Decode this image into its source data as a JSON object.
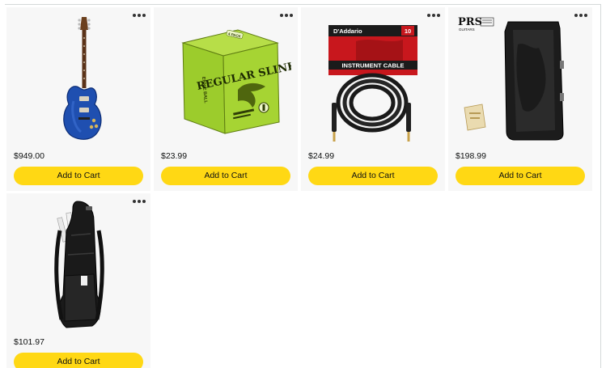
{
  "products": [
    {
      "image": "electric-guitar-image",
      "price": "$949.00",
      "cta": "Add to Cart"
    },
    {
      "image": "guitar-strings-4-pack-image",
      "price": "$23.99",
      "cta": "Add to Cart"
    },
    {
      "image": "instrument-cable-image",
      "price": "$24.99",
      "cta": "Add to Cart"
    },
    {
      "image": "guitar-hardshell-case-image",
      "price": "$198.99",
      "cta": "Add to Cart"
    },
    {
      "image": "double-guitar-gig-bag-image",
      "price": "$101.97",
      "cta": "Add to Cart"
    }
  ],
  "product_labels": {
    "strings_box_brand": "ERNIE BALL",
    "strings_box_pack": "4 PACK",
    "strings_box_name": "REGULAR SLINKY",
    "cable_brand": "D'Addario",
    "cable_label": "INSTRUMENT CABLE",
    "cable_length": "10",
    "case_logo": "PRS",
    "case_sub": "GUITARS"
  },
  "colors": {
    "accent_button": "#ffd814",
    "card_bg": "#f7f7f7",
    "text": "#0f1111",
    "guitar_blue": "#1f4fb0",
    "strings_green": "#9ccc2c",
    "cable_red": "#c8171d"
  }
}
